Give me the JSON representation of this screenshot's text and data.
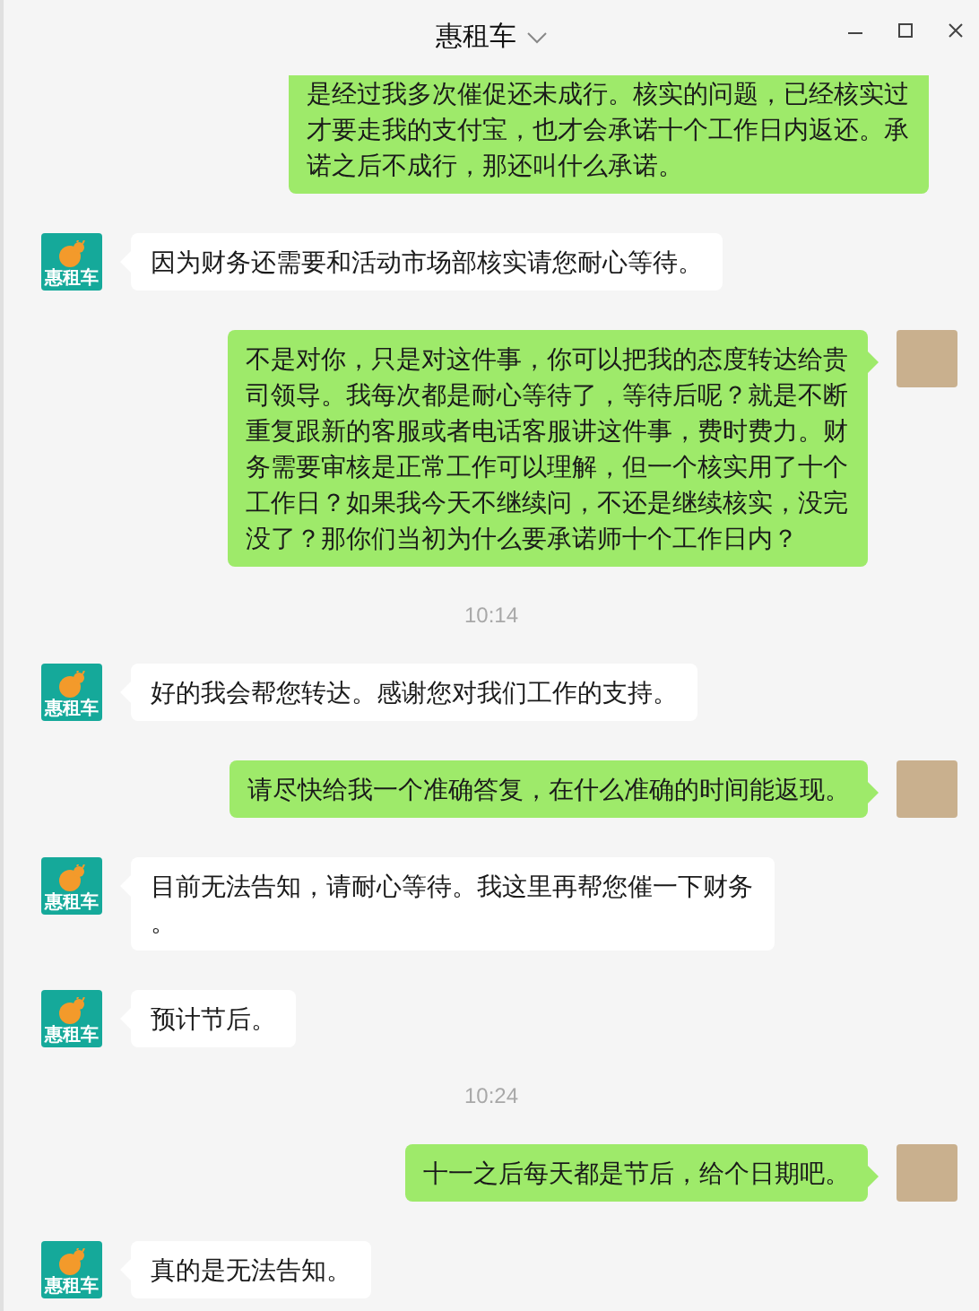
{
  "window": {
    "title": "惠租车"
  },
  "messages": [
    {
      "kind": "sent",
      "cut_off_top": true,
      "text": "是经过我多次催促还未成行。核实的问题，已经核实过才要走我的支付宝，也才会承诺十个工作日内返还。承诺之后不成行，那还叫什么承诺。"
    },
    {
      "kind": "received",
      "avatar_label": "惠租车",
      "text": "因为财务还需要和活动市场部核实请您耐心等待。"
    },
    {
      "kind": "sent",
      "cut_off_top": false,
      "text": "不是对你，只是对这件事，你可以把我的态度转达给贵司领导。我每次都是耐心等待了，等待后呢？就是不断重复跟新的客服或者电话客服讲这件事，费时费力。财务需要审核是正常工作可以理解，但一个核实用了十个工作日？如果我今天不继续问，不还是继续核实，没完没了？那你们当初为什么要承诺师十个工作日内？"
    },
    {
      "kind": "time",
      "text": "10:14"
    },
    {
      "kind": "received",
      "avatar_label": "惠租车",
      "text": "好的我会帮您转达。感谢您对我们工作的支持。"
    },
    {
      "kind": "sent",
      "cut_off_top": false,
      "text": "请尽快给我一个准确答复，在什么准确的时间能返现。"
    },
    {
      "kind": "received",
      "avatar_label": "惠租车",
      "text": "目前无法告知，请耐心等待。我这里再帮您催一下财务。"
    },
    {
      "kind": "received",
      "avatar_label": "惠租车",
      "text": "预计节后。"
    },
    {
      "kind": "time",
      "text": "10:24"
    },
    {
      "kind": "sent",
      "cut_off_top": false,
      "text": "十一之后每天都是节后，给个日期吧。"
    },
    {
      "kind": "received",
      "avatar_label": "惠租车",
      "text": "真的是无法告知。"
    }
  ]
}
